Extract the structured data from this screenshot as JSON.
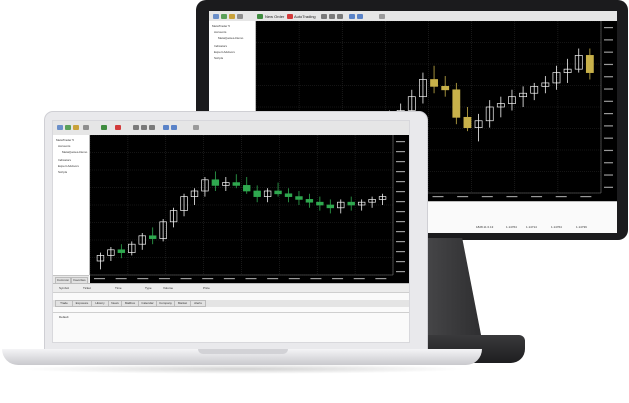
{
  "monitor": {
    "toolbar": {
      "new_order_label": "New Order",
      "autotrading_label": "AutoTrading"
    },
    "navigator": {
      "items": [
        "MetaTrader 5",
        "Accounts",
        "MetaQuotes-Demo",
        "Indicators",
        "Expert Advisors",
        "Scripts"
      ]
    },
    "candle_color": "#f5f5f5",
    "candle_color_alt": "#c8b14a",
    "terminal_values": [
      "Default",
      "1828.11 0.13",
      "1.14764",
      "1.14714",
      "1.14764",
      "1.14739"
    ]
  },
  "laptop": {
    "navigator": {
      "items": [
        "MetaTrader 5",
        "Accounts",
        "MetaQuotes-Demo",
        "Indicators",
        "Expert Advisors",
        "Scripts"
      ]
    },
    "candle_color": "#f5f5f5",
    "candle_color_alt": "#2fa84f",
    "terminal_tabs": [
      "Trade",
      "Exposure",
      "History",
      "News",
      "Mailbox",
      "Calendar",
      "Company",
      "Market",
      "Alerts"
    ],
    "nav_tabs": [
      "Common",
      "Favorites"
    ],
    "status_left": "Default",
    "terminal_headers": [
      "Symbol",
      "Ticket",
      "Time",
      "Type",
      "Volume",
      "Price"
    ]
  },
  "colors": {
    "chart_bg": "#000000",
    "grid": "#2a2a2a",
    "window_bg": "#f0f0f0"
  }
}
